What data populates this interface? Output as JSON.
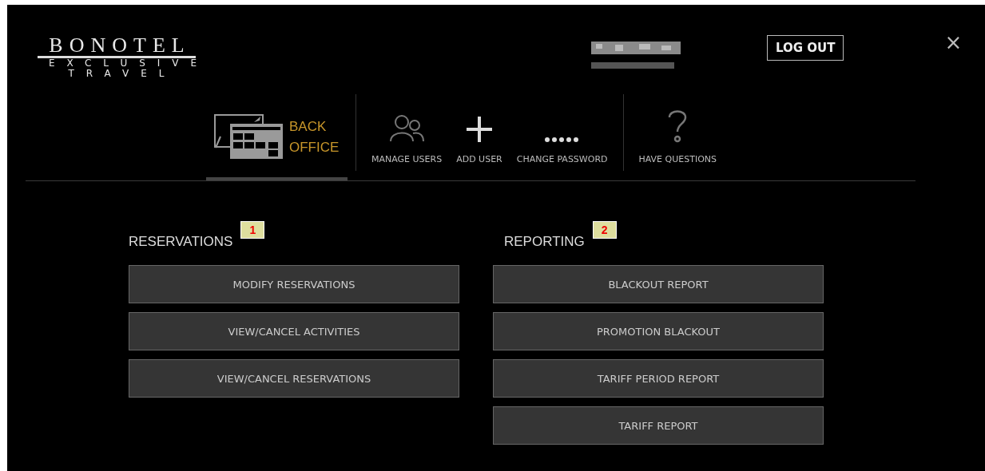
{
  "brand": {
    "name": "BONOTEL",
    "line_1": "EXCLUSIVE",
    "line_2": "TRAVEL"
  },
  "user": {
    "kind": "redacted"
  },
  "logout_button": "LOG OUT",
  "close": "×",
  "nav_groups": [
    {
      "items": [
        {
          "label": "BACK OFFICE",
          "kind": "back-office",
          "selected": true
        }
      ]
    },
    {
      "items": [
        {
          "label": "MANAGE USERS",
          "kind": "users",
          "selected": false
        },
        {
          "label": "ADD USER",
          "kind": "plus",
          "selected": false
        },
        {
          "label": "CHANGE PASSWORD",
          "kind": "dots",
          "selected": false
        }
      ]
    },
    {
      "items": [
        {
          "label": "HAVE QUESTIONS",
          "kind": "question",
          "selected": false
        }
      ]
    }
  ],
  "sections": [
    {
      "title": "RESERVATIONS",
      "badge": "1",
      "buttons": [
        "MODIFY RESERVATIONS",
        "VIEW/CANCEL ACTIVITIES",
        "VIEW/CANCEL RESERVATIONS"
      ]
    },
    {
      "title": "REPORTING",
      "badge": "2",
      "buttons": [
        "BLACKOUT REPORT",
        "PROMOTION BLACKOUT",
        "TARIFF PERIOD REPORT",
        "TARIFF REPORT"
      ]
    }
  ]
}
